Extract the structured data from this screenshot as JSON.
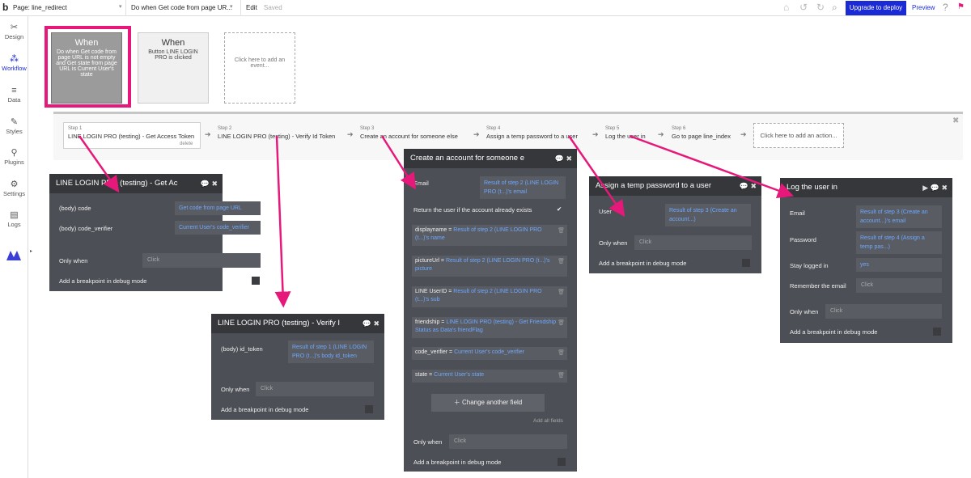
{
  "topbar": {
    "logo": "b",
    "page_label": "Page: line_redirect",
    "event_label": "Do when Get code from page UR...",
    "edit": "Edit",
    "saved": "Saved",
    "upgrade": "Upgrade to deploy",
    "preview": "Preview"
  },
  "sidebar": {
    "items": [
      {
        "label": "Design",
        "icon": "design-icon"
      },
      {
        "label": "Workflow",
        "icon": "workflow-icon"
      },
      {
        "label": "Data",
        "icon": "data-icon"
      },
      {
        "label": "Styles",
        "icon": "styles-icon"
      },
      {
        "label": "Plugins",
        "icon": "plugins-icon"
      },
      {
        "label": "Settings",
        "icon": "settings-icon"
      },
      {
        "label": "Logs",
        "icon": "logs-icon"
      }
    ]
  },
  "events": [
    {
      "title": "When",
      "text": "Do when Get code from page URL is not empty and Get state from page URL is Current User's state"
    },
    {
      "title": "When",
      "text": "Button LINE LOGIN PRO is clicked"
    },
    {
      "title": "",
      "text": "Click here to add an event..."
    }
  ],
  "steps": [
    {
      "num": "Step 1",
      "label": "LINE LOGIN PRO (testing) - Get Access Token",
      "delete": "delete"
    },
    {
      "num": "Step 2",
      "label": "LINE LOGIN PRO (testing) - Verify Id Token"
    },
    {
      "num": "Step 3",
      "label": "Create an account for someone else"
    },
    {
      "num": "Step 4",
      "label": "Assign a temp password to a user"
    },
    {
      "num": "Step 5",
      "label": "Log the user in"
    },
    {
      "num": "Step 6",
      "label": "Go to page line_index"
    },
    {
      "num": "",
      "label": "Click here to add an action..."
    }
  ],
  "panel1": {
    "title": "LINE LOGIN PRO (testing) - Get Ac",
    "f1_label": "(body) code",
    "f1_value": "Get code from page URL",
    "f2_label": "(body) code_verifier",
    "f2_value": "Current User's code_verifier",
    "only_when": "Only when",
    "click": "Click",
    "breakpoint": "Add a breakpoint in debug mode"
  },
  "panel2": {
    "title": "LINE LOGIN PRO (testing) - Verify I",
    "f1_label": "(body) id_token",
    "f1_value": "Result of step 1 (LINE LOGIN PRO (t...)'s body id_token",
    "only_when": "Only when",
    "click": "Click",
    "breakpoint": "Add a breakpoint in debug mode"
  },
  "panel3": {
    "title": "Create an account for someone e",
    "email_label": "Email",
    "email_value": "Result of step 2 (LINE LOGIN PRO (t...)'s email",
    "return_label": "Return the user if the account already exists",
    "fields": [
      {
        "name": "displayname =",
        "value": "Result of step 2 (LINE LOGIN PRO (t...)'s name"
      },
      {
        "name": "pictureUrl =",
        "value": "Result of step 2 (LINE LOGIN PRO (t...)'s picture"
      },
      {
        "name": "LINE UserID =",
        "value": "Result of step 2 (LINE LOGIN PRO (t...)'s sub"
      },
      {
        "name": "friendship =",
        "value": "LINE LOGIN PRO (testing) - Get Friendship Status as Data's friendFlag"
      },
      {
        "name": "code_verifier =",
        "value": "Current User's code_verifier"
      },
      {
        "name": "state =",
        "value": "Current User's state"
      }
    ],
    "change_field": "Change another field",
    "add_all": "Add all fields",
    "only_when": "Only when",
    "click": "Click",
    "breakpoint": "Add a breakpoint in debug mode"
  },
  "panel4": {
    "title": "Assign a temp password to a user",
    "user_label": "User",
    "user_value": "Result of step 3 (Create an account...)",
    "only_when": "Only when",
    "click": "Click",
    "breakpoint": "Add a breakpoint in debug mode"
  },
  "panel5": {
    "title": "Log the user in",
    "email_label": "Email",
    "email_value": "Result of step 3 (Create an account...)'s email",
    "password_label": "Password",
    "password_value": "Result of step 4 (Assign a temp pas...)",
    "stay_label": "Stay logged in",
    "stay_value": "yes",
    "remember_label": "Remember the email",
    "remember_value": "Click",
    "only_when": "Only when",
    "click": "Click",
    "breakpoint": "Add a breakpoint in debug mode"
  },
  "colors": {
    "accent": "#1a2bd6",
    "highlight": "#e6197a",
    "panel": "#4c4f55",
    "panel_header": "#35373b",
    "link": "#6fa8ff"
  }
}
